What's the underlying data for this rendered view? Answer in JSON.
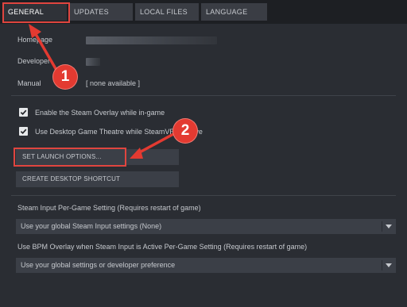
{
  "tabs": [
    {
      "label": "GENERAL",
      "active": true
    },
    {
      "label": "UPDATES",
      "active": false
    },
    {
      "label": "LOCAL FILES",
      "active": false
    },
    {
      "label": "LANGUAGE",
      "active": false
    }
  ],
  "general": {
    "homepage_label": "Homepage",
    "developer_label": "Developer",
    "manual_label": "Manual",
    "manual_value": "[ none available ]"
  },
  "checkboxes": [
    {
      "label": "Enable the Steam Overlay while in-game",
      "checked": true
    },
    {
      "label": "Use Desktop Game Theatre while SteamVR is active",
      "checked": true
    }
  ],
  "buttons": {
    "launch_options": "SET LAUNCH OPTIONS...",
    "desktop_shortcut": "CREATE DESKTOP SHORTCUT"
  },
  "steam_input": {
    "label": "Steam Input Per-Game Setting (Requires restart of game)",
    "selected": "Use your global Steam Input settings (None)"
  },
  "bpm_overlay": {
    "label": "Use BPM Overlay when Steam Input is Active Per-Game Setting (Requires restart of game)",
    "selected": "Use your global settings or developer preference"
  },
  "annotations": {
    "badge1": "1",
    "badge2": "2",
    "highlight_color": "#e0453f",
    "badge_color": "#e33a31"
  },
  "icons": {
    "checkbox": "check-icon",
    "dropdown": "chevron-down-icon"
  }
}
